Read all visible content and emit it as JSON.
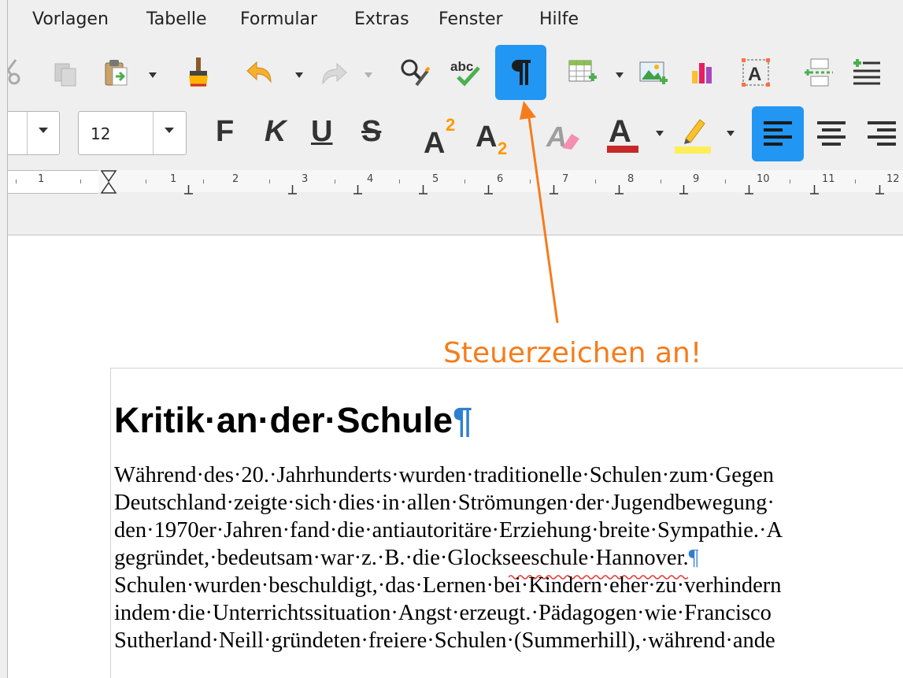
{
  "menubar": {
    "items": [
      "Vorlagen",
      "Tabelle",
      "Formular",
      "Extras",
      "Fenster",
      "Hilfe"
    ]
  },
  "toolbar": {
    "active_tool": "formatting-marks",
    "font_size": "12"
  },
  "ruler": {
    "numbers": [
      "1",
      "1",
      "2",
      "3",
      "4",
      "5",
      "6",
      "7",
      "8",
      "9",
      "10",
      "11",
      "12"
    ]
  },
  "annotation": {
    "text": "Steuerzeichen an!",
    "color": "#f57c1c"
  },
  "document": {
    "heading": "Kritik·an·der·Schule",
    "pilcrow": "¶",
    "lines": [
      "Während·des·20.·Jahrhunderts·wurden·traditionelle·Schulen·zum·Gegen",
      "Deutschland·zeigte·sich·dies·in·allen·Strömungen·der·Jugendbewegung·",
      "den·1970er·Jahren·fand·die·antiautoritäre·Erziehung·breite·Sympathie.·A",
      "gegründet,·bedeutsam·war·z.·B.·die·Glockseeschule·Hannover.",
      "Schulen·wurden·beschuldigt,·das·Lernen·bei·Kindern·eher·zu·verhindern",
      "indem·die·Unterrichtssituation·Angst·erzeugt.·Pädagogen·wie·Francisco",
      "Sutherland·Neill·gründeten·freiere·Schulen·(Summerhill),·während·ande"
    ],
    "misspelled_word": "Glockseeschule"
  },
  "colors": {
    "accent": "#2196f3",
    "annotation": "#f57c1c",
    "formatting_mark": "#2f7fd0"
  }
}
